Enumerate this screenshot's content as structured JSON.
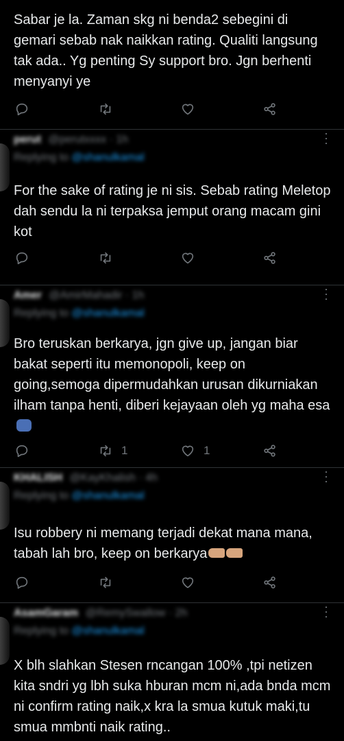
{
  "tweets": [
    {
      "author_name": "",
      "author_handle": "",
      "replying_to": "",
      "body": "Sabar je la. Zaman skg ni benda2 sebegini di gemari sebab nak naikkan rating. Qualiti langsung tak ada.. Yg penting Sy support bro. Jgn berhenti menyanyi ye",
      "retweets": "",
      "likes": ""
    },
    {
      "author_name": "perut",
      "author_handle": "@perutxxxx · 1h",
      "replying_to": "Replying to",
      "replying_handle": "@shanulkamal",
      "body": "For the sake of rating je ni sis. Sebab rating Meletop dah sendu la ni terpaksa jemput orang macam gini kot",
      "retweets": "",
      "likes": ""
    },
    {
      "author_name": "Amer",
      "author_handle": "@AmirMahadir · 1h",
      "replying_to": "Replying to",
      "replying_handle": "@shanulkamal",
      "body": "Bro teruskan berkarya, jgn give up, jangan biar bakat seperti itu memonopoli, keep on going,semoga dipermudahkan urusan dikurniakan ilham tanpa henti, diberi kejayaan oleh yg maha esa",
      "retweets": "1",
      "likes": "1"
    },
    {
      "author_name": "KHALISH",
      "author_handle": "@KayKhalish · 4h",
      "replying_to": "Replying to",
      "replying_handle": "@shanulkamal",
      "body": "Isu robbery ni memang terjadi dekat mana mana, tabah lah bro, keep on berkarya",
      "retweets": "",
      "likes": ""
    },
    {
      "author_name": "AsamGaram",
      "author_handle": "@RemySwallow · 2h",
      "replying_to": "Replying to",
      "replying_handle": "@shanulkamal",
      "body": "X blh slahkan Stesen rncangan 100% ,tpi netizen kita sndri yg lbh suka hburan mcm ni,ada bnda mcm ni confirm rating naik,x kra la smua kutuk maki,tu smua mmbnti naik rating..",
      "retweets": "",
      "likes": ""
    }
  ],
  "icons": {
    "reply": "reply-icon",
    "retweet": "retweet-icon",
    "like": "like-icon",
    "share": "share-icon",
    "more": "more-icon"
  },
  "colors": {
    "background": "#000000",
    "text": "#e7e9ea",
    "muted": "#71767b",
    "divider": "#2f3336",
    "link": "#1d9bf0"
  }
}
